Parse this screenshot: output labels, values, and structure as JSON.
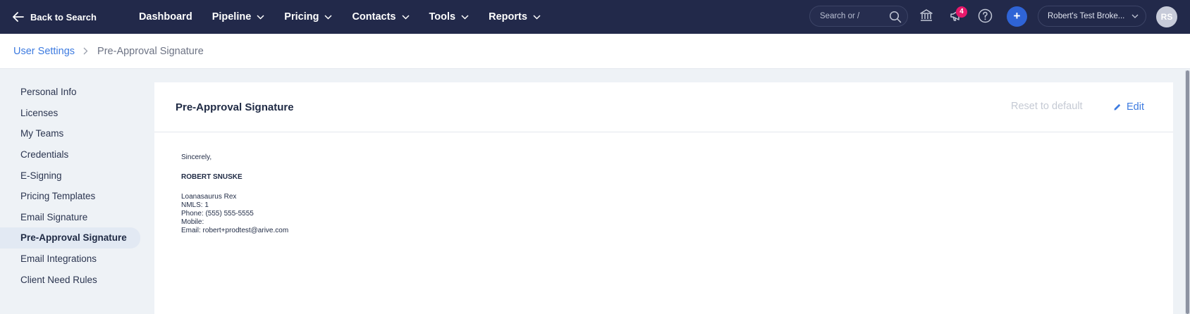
{
  "nav": {
    "back_label": "Back to Search",
    "items": [
      {
        "label": "Dashboard",
        "has_dropdown": false
      },
      {
        "label": "Pipeline",
        "has_dropdown": true
      },
      {
        "label": "Pricing",
        "has_dropdown": true
      },
      {
        "label": "Contacts",
        "has_dropdown": true
      },
      {
        "label": "Tools",
        "has_dropdown": true
      },
      {
        "label": "Reports",
        "has_dropdown": true
      }
    ],
    "search_placeholder": "Search or /",
    "notification_count": "4",
    "add_label": "+",
    "account_label": "Robert's Test Broke...",
    "avatar_initials": "RS",
    "icons": [
      "bank-icon",
      "megaphone-icon",
      "help-icon",
      "search-icon",
      "chevron-down-icon"
    ]
  },
  "breadcrumb": {
    "parent": "User Settings",
    "current": "Pre-Approval Signature"
  },
  "sidebar": {
    "items": [
      {
        "label": "Personal Info"
      },
      {
        "label": "Licenses"
      },
      {
        "label": "My Teams"
      },
      {
        "label": "Credentials"
      },
      {
        "label": "E-Signing"
      },
      {
        "label": "Pricing Templates"
      },
      {
        "label": "Email Signature"
      },
      {
        "label": "Pre-Approval Signature",
        "active": true
      },
      {
        "label": "Email Integrations"
      },
      {
        "label": "Client Need Rules"
      }
    ]
  },
  "card": {
    "title": "Pre-Approval Signature",
    "reset_label": "Reset to default",
    "edit_label": "Edit",
    "signature": {
      "closing": "Sincerely,",
      "name": "ROBERT SNUSKE",
      "company": "Loanasaurus Rex",
      "nmls": "NMLS: 1",
      "phone": "Phone: (555) 555-5555",
      "mobile": "Mobile:",
      "email": "Email: robert+prodtest@arive.com"
    }
  },
  "colors": {
    "nav_bg": "#22294a",
    "accent": "#3d7be0",
    "badge": "#e8196b",
    "add_button": "#2f64d6",
    "active_item_bg": "#e2e9f3"
  }
}
